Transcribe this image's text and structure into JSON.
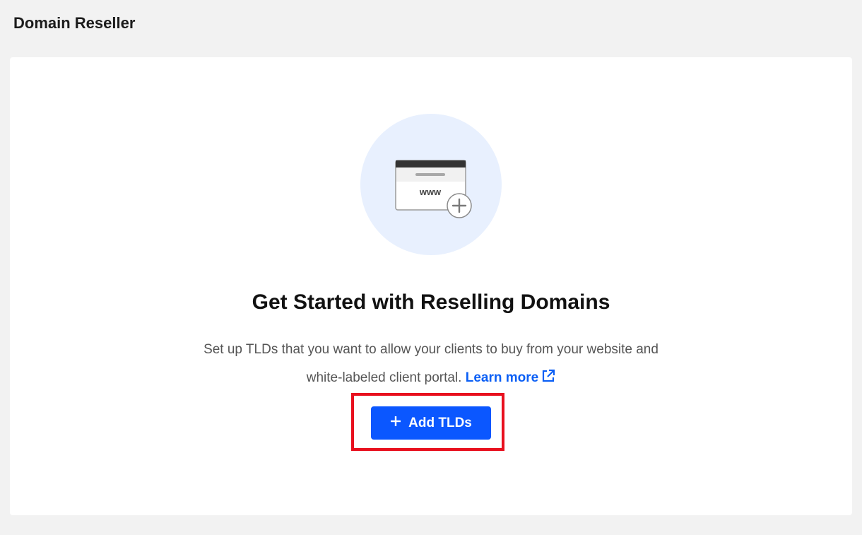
{
  "page": {
    "title": "Domain Reseller"
  },
  "empty_state": {
    "illustration_text": "www",
    "headline": "Get Started with Reselling Domains",
    "description_line1": "Set up TLDs that you want to allow your clients to buy from your website and",
    "description_line2": "white-labeled client portal.",
    "learn_more_label": "Learn more",
    "add_button_label": "Add TLDs"
  },
  "colors": {
    "primary": "#0b57ff",
    "link": "#0b5ff5",
    "highlight": "#e8101e",
    "illustration_bg": "#e8f0fe",
    "page_bg": "#f2f2f2"
  },
  "icons": {
    "illustration": "browser-window-www-plus-icon",
    "learn_more": "external-link-icon",
    "add_button": "plus-icon"
  }
}
